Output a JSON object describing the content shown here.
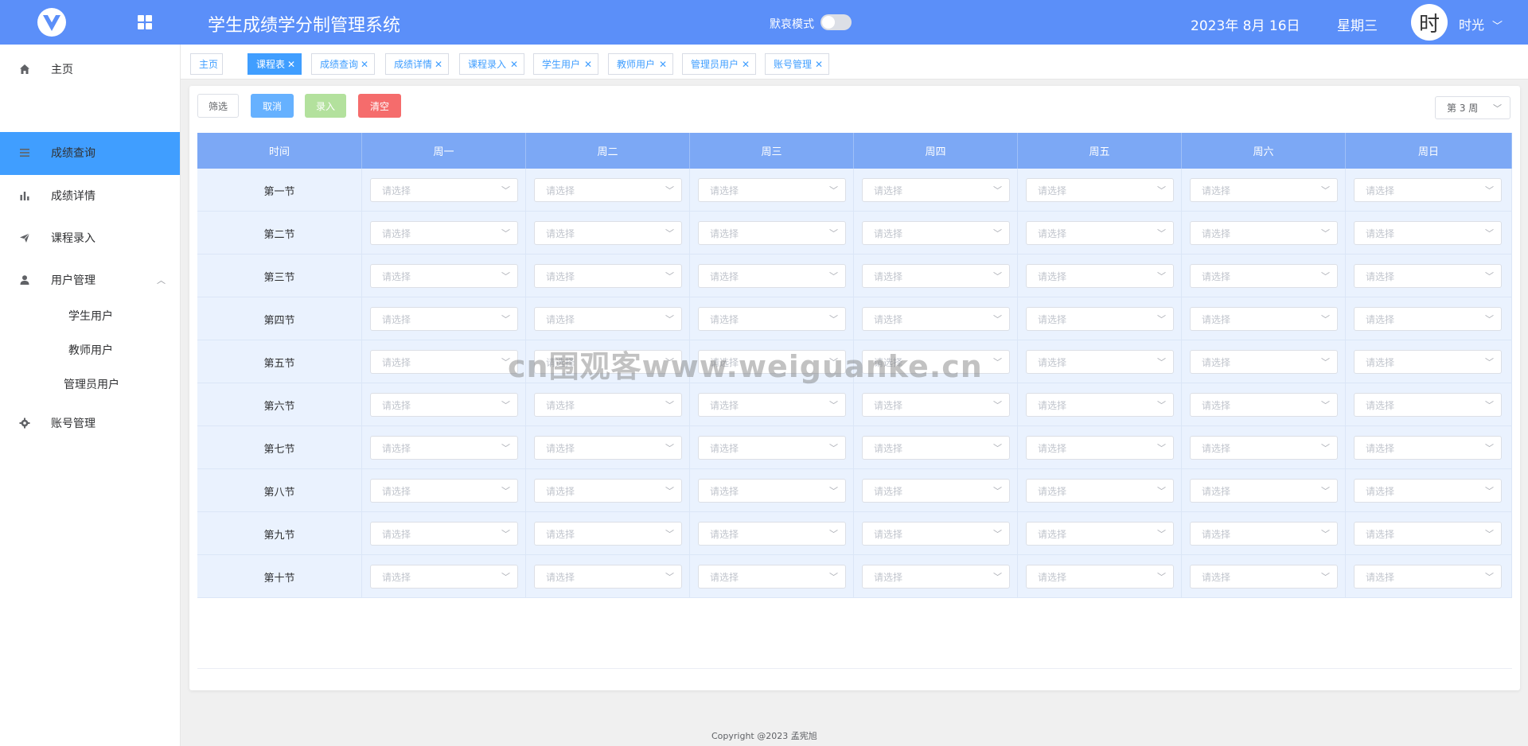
{
  "header": {
    "title": "学生成绩学分制管理系统",
    "mode_label": "默哀模式",
    "mode_on": false,
    "date": "2023年 8月 16日",
    "weekday": "星期三",
    "avatar_text": "时",
    "username": "时光",
    "accent_color": "#5b8ff9"
  },
  "sidebar": {
    "items": [
      {
        "label": "主页",
        "icon": "home-icon"
      },
      {
        "label": "成绩查询",
        "icon": "list-icon"
      },
      {
        "label": "成绩详情",
        "icon": "bar-chart-icon"
      },
      {
        "label": "课程录入",
        "icon": "send-icon"
      },
      {
        "label": "用户管理",
        "icon": "user-icon"
      },
      {
        "label": "账号管理",
        "icon": "gear-icon"
      }
    ],
    "user_sub": [
      "学生用户",
      "教师用户",
      "管理员用户"
    ]
  },
  "tabs": [
    {
      "label": "主页",
      "closable": false
    },
    {
      "label": "课程表",
      "closable": true,
      "active": true
    },
    {
      "label": "成绩查询",
      "closable": true
    },
    {
      "label": "成绩详情",
      "closable": true
    },
    {
      "label": "课程录入",
      "closable": true
    },
    {
      "label": "学生用户",
      "closable": true
    },
    {
      "label": "教师用户",
      "closable": true
    },
    {
      "label": "管理员用户",
      "closable": true
    },
    {
      "label": "账号管理",
      "closable": true
    }
  ],
  "toolbar": {
    "filter": "筛选",
    "cancel": "取消",
    "enter": "录入",
    "clear": "清空",
    "week": "第 3 周"
  },
  "table": {
    "headers": [
      "时间",
      "周一",
      "周二",
      "周三",
      "周四",
      "周五",
      "周六",
      "周日"
    ],
    "rows": [
      "第一节",
      "第二节",
      "第三节",
      "第四节",
      "第五节",
      "第六节",
      "第七节",
      "第八节",
      "第九节",
      "第十节"
    ],
    "placeholder": "请选择"
  },
  "watermark": "cn围观客www.weiguanke.cn",
  "footer": "Copyright @2023 孟宪旭"
}
